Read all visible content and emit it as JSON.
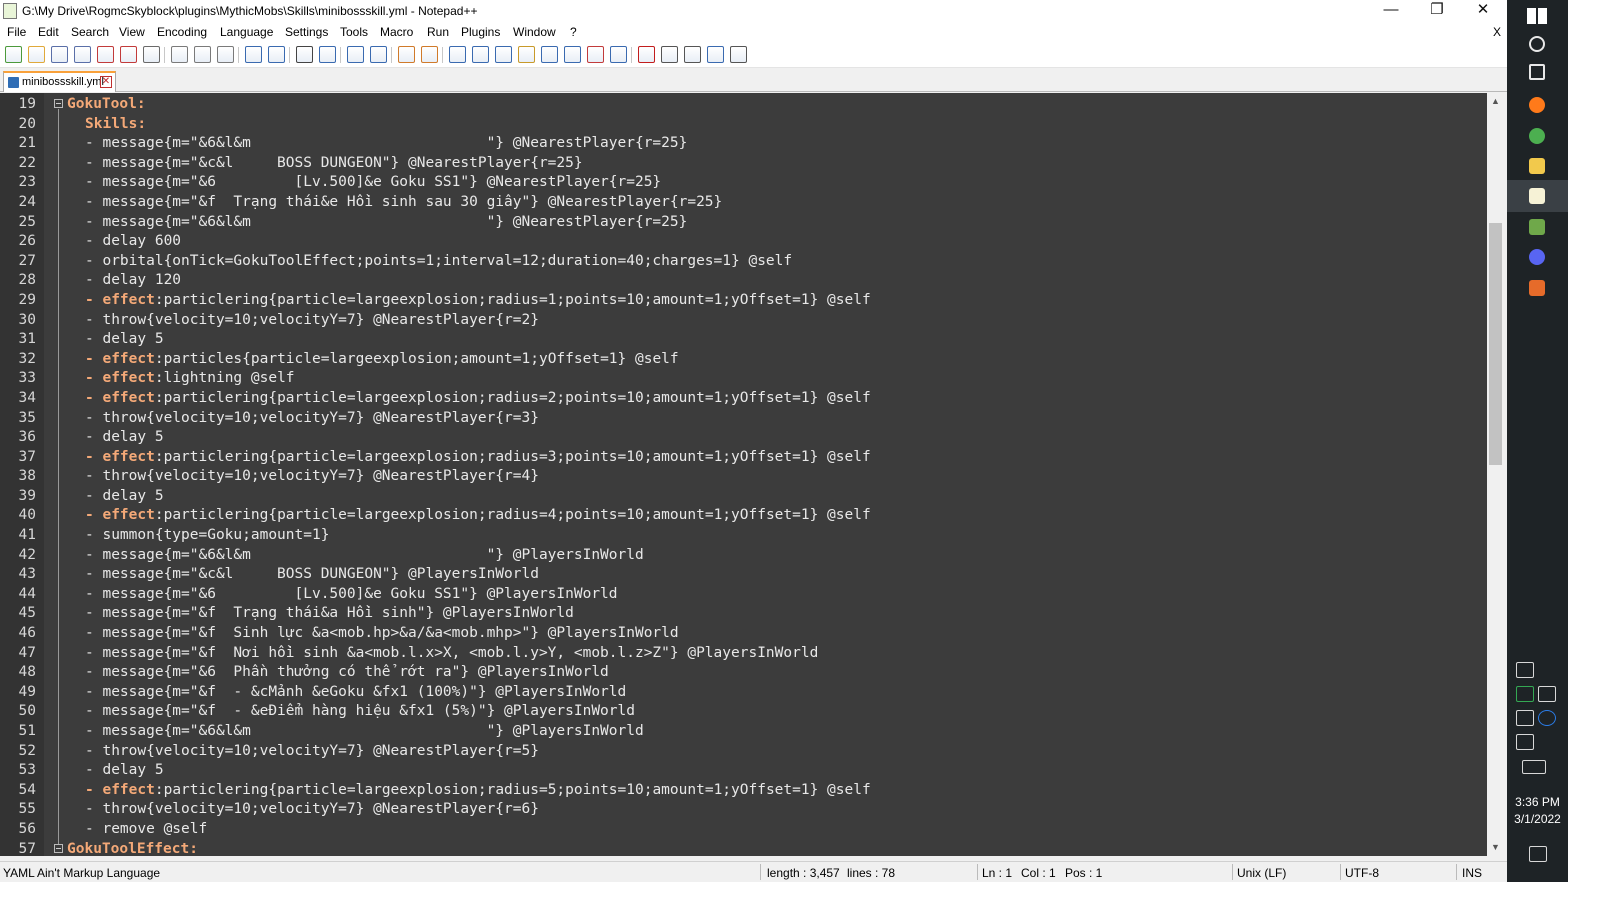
{
  "window": {
    "title": "G:\\My Drive\\RogmcSkyblock\\plugins\\MythicMobs\\Skills\\minibossskill.yml - Notepad++",
    "minimize": "—",
    "restore": "❐",
    "close": "✕"
  },
  "menu": {
    "items": [
      "File",
      "Edit",
      "Search",
      "View",
      "Encoding",
      "Language",
      "Settings",
      "Tools",
      "Macro",
      "Run",
      "Plugins",
      "Window",
      "?"
    ],
    "close_doc": "X"
  },
  "toolbar_icons": [
    "new-file-icon",
    "open-file-icon",
    "save-icon",
    "save-all-icon",
    "close-icon",
    "close-all-icon",
    "print-icon",
    "cut-icon",
    "copy-icon",
    "paste-icon",
    "undo-icon",
    "redo-icon",
    "find-icon",
    "replace-icon",
    "zoom-in-icon",
    "zoom-out-icon",
    "sync-vertical-icon",
    "sync-horizontal-icon",
    "word-wrap-icon",
    "show-all-characters-icon",
    "indent-guide-icon",
    "user-defined-language-icon",
    "document-map-icon",
    "function-list-icon",
    "folder-as-workspace-icon",
    "monitoring-icon",
    "record-macro-icon",
    "stop-record-icon",
    "play-macro-icon",
    "run-macro-multiple-icon",
    "save-macro-icon"
  ],
  "tab": {
    "label": "minibossskill.yml",
    "close": "✕"
  },
  "editor": {
    "lines": [
      {
        "n": "19",
        "type": "key",
        "text": "GokuTool:"
      },
      {
        "n": "20",
        "type": "subkey",
        "text": "Skills:"
      },
      {
        "n": "21",
        "type": "plain",
        "text": "- message{m=\"&6&l&m                           \"} @NearestPlayer{r=25}"
      },
      {
        "n": "22",
        "type": "plain",
        "text": "- message{m=\"&c&l     BOSS DUNGEON\"} @NearestPlayer{r=25}"
      },
      {
        "n": "23",
        "type": "plain",
        "text": "- message{m=\"&6         [Lv.500]&e Goku SS1\"} @NearestPlayer{r=25}"
      },
      {
        "n": "24",
        "type": "plain",
        "text": "- message{m=\"&f  Trạng thái&e Hồi sinh sau 30 giây\"} @NearestPlayer{r=25}"
      },
      {
        "n": "25",
        "type": "plain",
        "text": "- message{m=\"&6&l&m                           \"} @NearestPlayer{r=25}"
      },
      {
        "n": "26",
        "type": "plain",
        "text": "- delay 600"
      },
      {
        "n": "27",
        "type": "plain",
        "text": "- orbital{onTick=GokuToolEffect;points=1;interval=12;duration=40;charges=1} @self"
      },
      {
        "n": "28",
        "type": "plain",
        "text": "- delay 120"
      },
      {
        "n": "29",
        "type": "effect",
        "kw": "effect",
        "text": ":particlering{particle=largeexplosion;radius=1;points=10;amount=1;yOffset=1} @self"
      },
      {
        "n": "30",
        "type": "plain",
        "text": "- throw{velocity=10;velocityY=7} @NearestPlayer{r=2}"
      },
      {
        "n": "31",
        "type": "plain",
        "text": "- delay 5"
      },
      {
        "n": "32",
        "type": "effect",
        "kw": "effect",
        "text": ":particles{particle=largeexplosion;amount=1;yOffset=1} @self"
      },
      {
        "n": "33",
        "type": "effect",
        "kw": "effect",
        "text": ":lightning @self"
      },
      {
        "n": "34",
        "type": "effect",
        "kw": "effect",
        "text": ":particlering{particle=largeexplosion;radius=2;points=10;amount=1;yOffset=1} @self"
      },
      {
        "n": "35",
        "type": "plain",
        "text": "- throw{velocity=10;velocityY=7} @NearestPlayer{r=3}"
      },
      {
        "n": "36",
        "type": "plain",
        "text": "- delay 5"
      },
      {
        "n": "37",
        "type": "effect",
        "kw": "effect",
        "text": ":particlering{particle=largeexplosion;radius=3;points=10;amount=1;yOffset=1} @self"
      },
      {
        "n": "38",
        "type": "plain",
        "text": "- throw{velocity=10;velocityY=7} @NearestPlayer{r=4}"
      },
      {
        "n": "39",
        "type": "plain",
        "text": "- delay 5"
      },
      {
        "n": "40",
        "type": "effect",
        "kw": "effect",
        "text": ":particlering{particle=largeexplosion;radius=4;points=10;amount=1;yOffset=1} @self"
      },
      {
        "n": "41",
        "type": "plain",
        "text": "- summon{type=Goku;amount=1}"
      },
      {
        "n": "42",
        "type": "plain",
        "text": "- message{m=\"&6&l&m                           \"} @PlayersInWorld"
      },
      {
        "n": "43",
        "type": "plain",
        "text": "- message{m=\"&c&l     BOSS DUNGEON\"} @PlayersInWorld"
      },
      {
        "n": "44",
        "type": "plain",
        "text": "- message{m=\"&6         [Lv.500]&e Goku SS1\"} @PlayersInWorld"
      },
      {
        "n": "45",
        "type": "plain",
        "text": "- message{m=\"&f  Trạng thái&a Hồi sinh\"} @PlayersInWorld"
      },
      {
        "n": "46",
        "type": "plain",
        "text": "- message{m=\"&f  Sinh lực &a<mob.hp>&a/&a<mob.mhp>\"} @PlayersInWorld"
      },
      {
        "n": "47",
        "type": "plain",
        "text": "- message{m=\"&f  Nơi hồi sinh &a<mob.l.x>X, <mob.l.y>Y, <mob.l.z>Z\"} @PlayersInWorld"
      },
      {
        "n": "48",
        "type": "plain",
        "text": "- message{m=\"&6  Phần thưởng có thể rớt ra\"} @PlayersInWorld"
      },
      {
        "n": "49",
        "type": "plain",
        "text": "- message{m=\"&f  - &cMảnh &eGoku &fx1 (100%)\"} @PlayersInWorld"
      },
      {
        "n": "50",
        "type": "plain",
        "text": "- message{m=\"&f  - &eĐiểm hàng hiệu &fx1 (5%)\"} @PlayersInWorld"
      },
      {
        "n": "51",
        "type": "plain",
        "text": "- message{m=\"&6&l&m                           \"} @PlayersInWorld"
      },
      {
        "n": "52",
        "type": "plain",
        "text": "- throw{velocity=10;velocityY=7} @NearestPlayer{r=5}"
      },
      {
        "n": "53",
        "type": "plain",
        "text": "- delay 5"
      },
      {
        "n": "54",
        "type": "effect",
        "kw": "effect",
        "text": ":particlering{particle=largeexplosion;radius=5;points=10;amount=1;yOffset=1} @self"
      },
      {
        "n": "55",
        "type": "plain",
        "text": "- throw{velocity=10;velocityY=7} @NearestPlayer{r=6}"
      },
      {
        "n": "56",
        "type": "plain",
        "text": "- remove @self"
      },
      {
        "n": "57",
        "type": "key",
        "text": "GokuToolEffect:"
      }
    ]
  },
  "status": {
    "language": "YAML Ain't Markup Language",
    "length": "length : 3,457",
    "lines": "lines : 78",
    "ln": "Ln : 1",
    "col": "Col : 1",
    "pos": "Pos : 1",
    "eol": "Unix (LF)",
    "encoding": "UTF-8",
    "mode": "INS"
  },
  "taskbar": {
    "apps": [
      "windows-start-icon",
      "search-icon",
      "task-view-icon",
      "firefox-icon",
      "chrome-icon",
      "file-explorer-icon",
      "notepad-plus-plus-icon",
      "minecraft-icon",
      "discord-icon",
      "office-icon"
    ],
    "time": "3:36 PM",
    "date": "3/1/2022",
    "tray": [
      "show-hidden-icons-icon",
      "google-drive-icon",
      "network-icon",
      "volume-icon",
      "bluetooth-icon",
      "pen-icon",
      "keyboard-icon",
      "notifications-icon"
    ]
  }
}
